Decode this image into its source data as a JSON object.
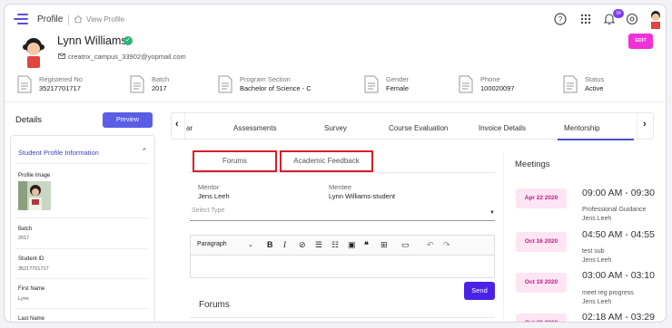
{
  "topbar": {
    "title": "Profile",
    "breadcrumb": "View Profile",
    "notification_count": "34"
  },
  "profile": {
    "name": "Lynn Williams",
    "email": "creatrix_campus_33902@yopmail.com",
    "edit_label": "EDIT"
  },
  "info": [
    {
      "label": "Registered No",
      "value": "35217701717"
    },
    {
      "label": "Batch",
      "value": "2017"
    },
    {
      "label": "Program Section",
      "value": "Bachelor of Science - C"
    },
    {
      "label": "Gender",
      "value": "Female"
    },
    {
      "label": "Phone",
      "value": "100020097"
    },
    {
      "label": "Status",
      "value": "Active"
    }
  ],
  "left": {
    "title": "Details",
    "preview_label": "Preview",
    "section_title": "Student Profile Information",
    "profile_image_label": "Profile Image",
    "fields": [
      {
        "label": "Batch",
        "value": "2017"
      },
      {
        "label": "Student ID",
        "value": "35217701717"
      },
      {
        "label": "First Name",
        "value": "Lynn"
      },
      {
        "label": "Last Name",
        "value": ""
      }
    ]
  },
  "tabs": {
    "items": [
      "ar",
      "Assessments",
      "Survey",
      "Course Evaluation",
      "Invoice Details",
      "Mentorship"
    ],
    "active": "Mentorship"
  },
  "mentorship": {
    "sub_tabs": [
      "Forums",
      "Academic Feedback"
    ],
    "mentor_label": "Mentor",
    "mentor_value": "Jens Leeh",
    "mentee_label": "Mentee",
    "mentee_value": "Lynn Williams-student",
    "select_placeholder": "Select Type",
    "paragraph_label": "Paragraph",
    "send_label": "Send",
    "forums_title": "Forums"
  },
  "meetings": {
    "title": "Meetings",
    "items": [
      {
        "date": "Apr 22 2020",
        "time": "09:00 AM - 09:30",
        "subject": "Professional Guidance",
        "who": "Jens Leeh"
      },
      {
        "date": "Oct 16 2020",
        "time": "04:50 AM - 04:55",
        "subject": "test sub",
        "who": "Jens Leeh"
      },
      {
        "date": "Oct 19 2020",
        "time": "03:00 AM - 03:10",
        "subject": "meet reg progress",
        "who": "Jens Leeh"
      },
      {
        "date": "Oct 20 2020",
        "time": "02:18 AM - 03:29",
        "subject": "",
        "who": ""
      }
    ]
  },
  "colors": {
    "accent": "#5a5ee6",
    "edit": "#f030d9",
    "send": "#4a22e6",
    "highlight_box": "#d6202a",
    "meeting_date_bg": "#fde5f3"
  }
}
